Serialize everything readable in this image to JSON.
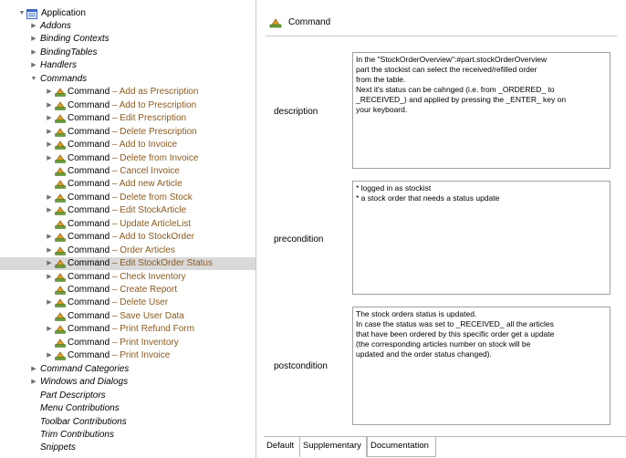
{
  "tree": {
    "root": "Application",
    "items": [
      {
        "text": "Addons",
        "style": "italic",
        "twisty": "right"
      },
      {
        "text": "Binding Contexts",
        "style": "italic",
        "twisty": "right"
      },
      {
        "text": "BindingTables",
        "style": "italic",
        "twisty": "right"
      },
      {
        "text": "Handlers",
        "style": "italic",
        "twisty": "right"
      },
      {
        "text": "Commands",
        "style": "italic",
        "twisty": "down"
      },
      {
        "type": "Command",
        "name": "Add as Prescription",
        "twisty": "right"
      },
      {
        "type": "Command",
        "name": "Add to Prescription",
        "twisty": "right"
      },
      {
        "type": "Command",
        "name": "Edit Prescription",
        "twisty": "right"
      },
      {
        "type": "Command",
        "name": "Delete Prescription",
        "twisty": "right"
      },
      {
        "type": "Command",
        "name": "Add to Invoice",
        "twisty": "right"
      },
      {
        "type": "Command",
        "name": "Delete from Invoice",
        "twisty": "right"
      },
      {
        "type": "Command",
        "name": "Cancel Invoice",
        "twisty": "none"
      },
      {
        "type": "Command",
        "name": "Add new Article",
        "twisty": "none"
      },
      {
        "type": "Command",
        "name": "Delete from Stock",
        "twisty": "right"
      },
      {
        "type": "Command",
        "name": "Edit StockArticle",
        "twisty": "right"
      },
      {
        "type": "Command",
        "name": "Update ArticleList",
        "twisty": "none"
      },
      {
        "type": "Command",
        "name": "Add to StockOrder",
        "twisty": "right"
      },
      {
        "type": "Command",
        "name": "Order Articles",
        "twisty": "right"
      },
      {
        "type": "Command",
        "name": "Edit StockOrder Status",
        "twisty": "right",
        "selected": true
      },
      {
        "type": "Command",
        "name": "Check Inventory",
        "twisty": "right"
      },
      {
        "type": "Command",
        "name": "Create Report",
        "twisty": "none"
      },
      {
        "type": "Command",
        "name": "Delete User",
        "twisty": "right"
      },
      {
        "type": "Command",
        "name": "Save User Data",
        "twisty": "none"
      },
      {
        "type": "Command",
        "name": "Print Refund Form",
        "twisty": "right"
      },
      {
        "type": "Command",
        "name": "Print Inventory",
        "twisty": "none"
      },
      {
        "type": "Command",
        "name": "Print Invoice",
        "twisty": "right"
      },
      {
        "text": "Command Categories",
        "style": "italic",
        "twisty": "right"
      },
      {
        "text": "Windows and Dialogs",
        "style": "italic",
        "twisty": "right"
      },
      {
        "text": "Part Descriptors",
        "style": "italic",
        "twisty": "none"
      },
      {
        "text": "Menu Contributions",
        "style": "italic",
        "twisty": "none"
      },
      {
        "text": "Toolbar Contributions",
        "style": "italic",
        "twisty": "none"
      },
      {
        "text": "Trim Contributions",
        "style": "italic",
        "twisty": "none"
      },
      {
        "text": "Snippets",
        "style": "italic",
        "twisty": "none"
      }
    ]
  },
  "editor": {
    "title": "Command",
    "description_label": "description",
    "description_lines": [
      "In the \"StockOrderOverview\":#part.stockOrderOverview",
      "part the stockist can select the received/refilled order",
      "from the table.",
      "Next it's status can be cahnged (i.e. from _ORDERED_ to",
      "_RECEIVED_) and applied by pressing the _ENTER_ key on",
      "your keyboard."
    ],
    "precondition_label": "precondition",
    "precondition_lines": [
      "* logged in as stockist",
      "* a stock order that needs a status update"
    ],
    "postcondition_label": "postcondition",
    "postcondition_lines": [
      "The stock orders status is updated.",
      "In case the status was set to _RECEIVED_ all the articles",
      "that have been ordered by this specific order get a update",
      "(the corresponding articles number on stock will be",
      "updated and the order status changed)."
    ]
  },
  "tabs": [
    "Default",
    "Supplementary",
    "Documentation"
  ],
  "active_tab": "Documentation",
  "colors": {
    "command_name": "#8a5a1e",
    "selection": "#d9d9d9",
    "accent_icon": "#e0a020"
  }
}
